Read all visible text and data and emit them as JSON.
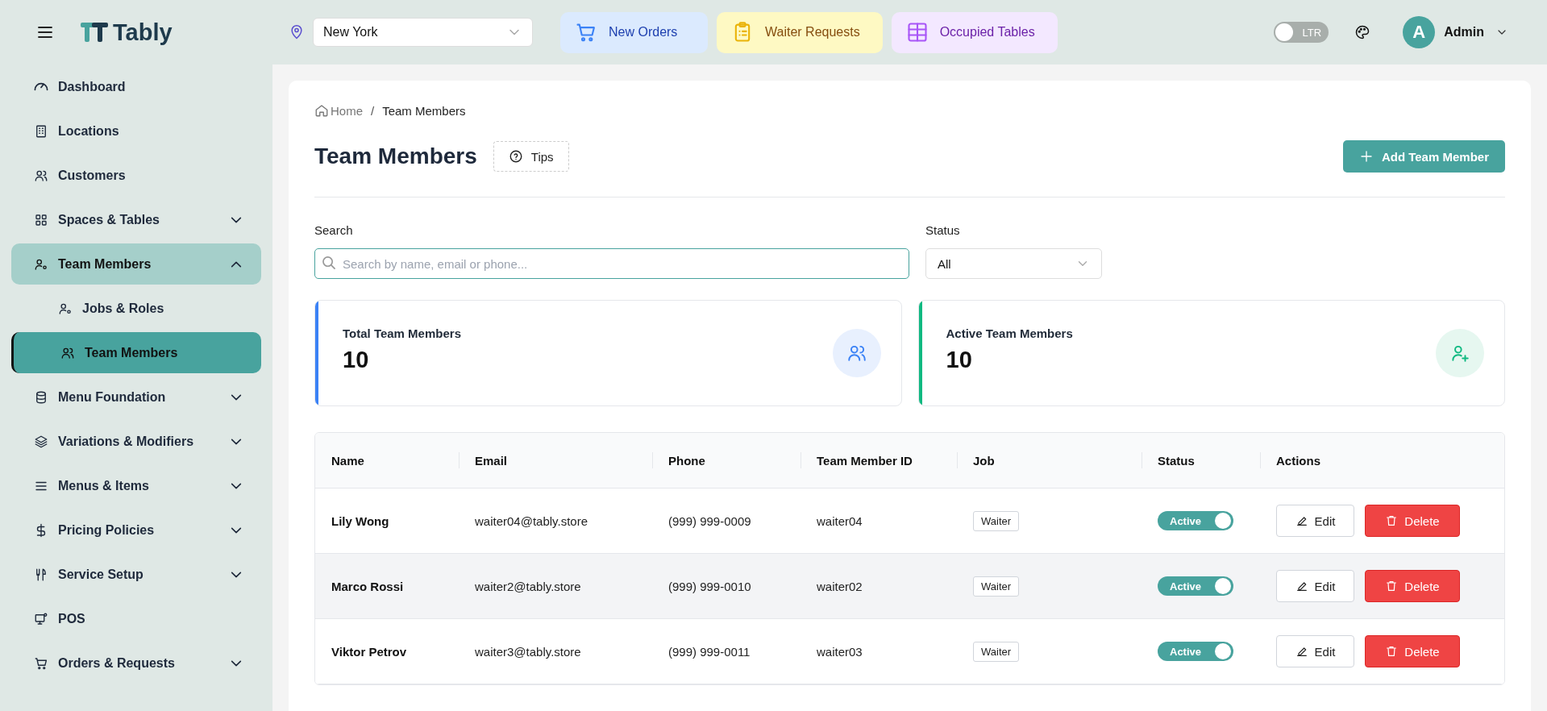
{
  "topbar": {
    "logo": "Tably",
    "location": {
      "value": "New York"
    },
    "quick_buttons": [
      {
        "label": "New Orders",
        "kind": "orders"
      },
      {
        "label": "Waiter Requests",
        "kind": "requests"
      },
      {
        "label": "Occupied Tables",
        "kind": "tables"
      }
    ],
    "direction_toggle": {
      "label": "LTR",
      "on": false
    },
    "user": {
      "initial": "A",
      "name": "Admin"
    }
  },
  "sidebar": {
    "items": [
      {
        "label": "Dashboard",
        "kind": "link",
        "selected": false
      },
      {
        "label": "Locations",
        "kind": "link",
        "selected": false
      },
      {
        "label": "Customers",
        "kind": "link",
        "selected": false
      },
      {
        "label": "Spaces & Tables",
        "kind": "group",
        "expanded": false,
        "selected": false
      },
      {
        "label": "Team Members",
        "kind": "group",
        "expanded": true,
        "selected": false,
        "children": [
          {
            "label": "Jobs & Roles",
            "kind": "link",
            "selected": false
          },
          {
            "label": "Team Members",
            "kind": "link",
            "selected": true
          }
        ]
      },
      {
        "label": "Menu Foundation",
        "kind": "group",
        "expanded": false,
        "selected": false
      },
      {
        "label": "Variations & Modifiers",
        "kind": "group",
        "expanded": false,
        "selected": false
      },
      {
        "label": "Menus & Items",
        "kind": "group",
        "expanded": false,
        "selected": false
      },
      {
        "label": "Pricing Policies",
        "kind": "group",
        "expanded": false,
        "selected": false
      },
      {
        "label": "Service Setup",
        "kind": "group",
        "expanded": false,
        "selected": false
      },
      {
        "label": "POS",
        "kind": "link",
        "selected": false
      },
      {
        "label": "Orders & Requests",
        "kind": "group",
        "expanded": false,
        "selected": false
      }
    ]
  },
  "page": {
    "breadcrumb": [
      "Home",
      "Team Members"
    ],
    "breadcrumb_separator": "/",
    "title": "Team Members",
    "tips_button": "Tips",
    "add_button": "Add Team Member",
    "search": {
      "label": "Search",
      "placeholder": "Search by name, email or phone..."
    },
    "status_filter": {
      "label": "Status",
      "value": "All"
    },
    "stats": [
      {
        "label": "Total Team Members",
        "value": "10",
        "color": "#3b82f6"
      },
      {
        "label": "Active Team Members",
        "value": "10",
        "color": "#10b981"
      }
    ],
    "table": {
      "columns": [
        "Name",
        "Email",
        "Phone",
        "Team Member ID",
        "Job",
        "Status",
        "Actions"
      ],
      "rows": [
        {
          "name": "Lily Wong",
          "email": "waiter04@tably.store",
          "phone": "(999) 999-0009",
          "member_id": "waiter04",
          "job": "Waiter",
          "status": {
            "label": "Active",
            "on": true
          },
          "actions": [
            "Edit",
            "Delete"
          ],
          "selected": false
        },
        {
          "name": "Marco Rossi",
          "email": "waiter2@tably.store",
          "phone": "(999) 999-0010",
          "member_id": "waiter02",
          "job": "Waiter",
          "status": {
            "label": "Active",
            "on": true
          },
          "actions": [
            "Edit",
            "Delete"
          ],
          "selected": false
        },
        {
          "name": "Viktor Petrov",
          "email": "waiter3@tably.store",
          "phone": "(999) 999-0011",
          "member_id": "waiter03",
          "job": "Waiter",
          "status": {
            "label": "Active",
            "on": true
          },
          "actions": [
            "Edit",
            "Delete"
          ],
          "selected": false
        }
      ]
    }
  }
}
